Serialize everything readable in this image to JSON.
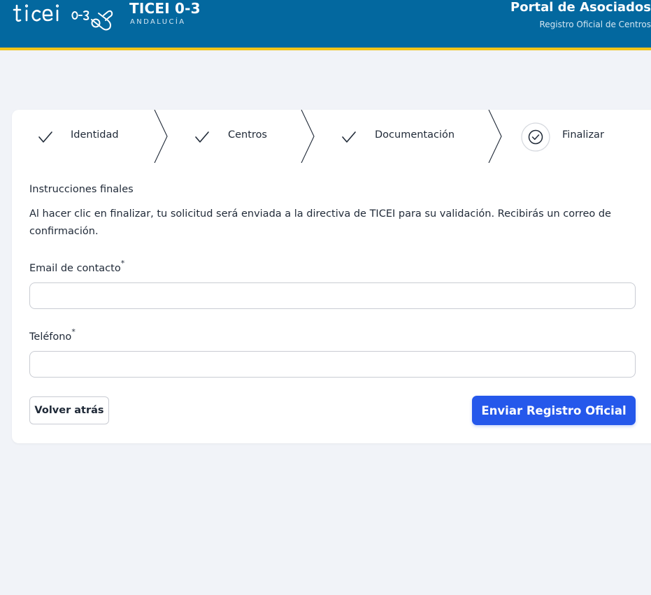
{
  "header": {
    "logo_text": "ticei 0-3",
    "brand_title": "TICEI 0-3",
    "brand_subtitle": "ANDALUCÍA",
    "portal_title": "Portal de Asociados",
    "portal_subtitle": "Registro Oficial de Centros"
  },
  "steps": [
    {
      "label": "Identidad",
      "status": "done",
      "icon": "check-icon"
    },
    {
      "label": "Centros",
      "status": "done",
      "icon": "check-icon"
    },
    {
      "label": "Documentación",
      "status": "done",
      "icon": "check-icon"
    },
    {
      "label": "Finalizar",
      "status": "current",
      "icon": "circle-check-icon"
    }
  ],
  "form": {
    "section_title": "Instrucciones finales",
    "instructions": "Al hacer clic en finalizar, tu solicitud será enviada a la directiva de TICEI para su validación. Recibirás un correo de confirmación.",
    "email_label": "Email de contacto",
    "email_value": "",
    "phone_label": "Teléfono",
    "phone_value": "",
    "required_mark": "*"
  },
  "actions": {
    "back_label": "Volver atrás",
    "submit_label": "Enviar Registro Oficial"
  },
  "colors": {
    "header_bg": "#03689f",
    "header_accent": "#f2c418",
    "primary": "#2558eb",
    "page_bg": "#f1f3f8"
  }
}
